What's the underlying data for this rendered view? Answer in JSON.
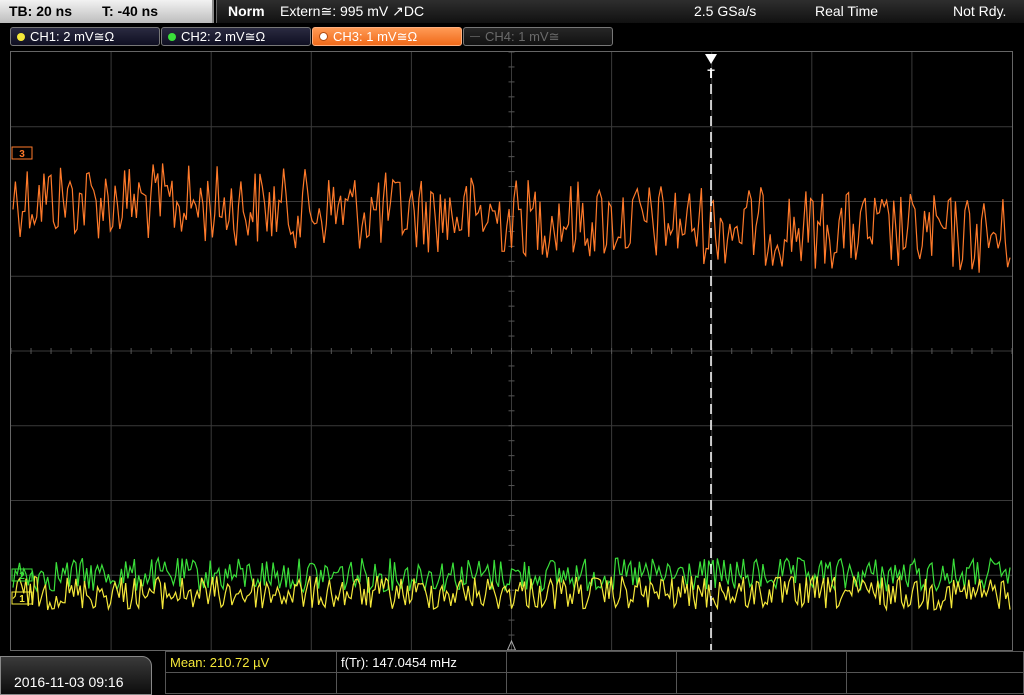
{
  "top": {
    "timebase": "TB: 20 ns",
    "trigger_offset": "T: -40 ns",
    "trigger_mode": "Norm",
    "trigger_source": "Extern≅: 995 mV ↗DC",
    "sample_rate": "2.5 GSa/s",
    "acq_mode": "Real Time",
    "status": "Not Rdy."
  },
  "channels": [
    {
      "label": "CH1: 2 mV≅Ω",
      "color": "#f5e83a",
      "state": "on"
    },
    {
      "label": "CH2: 2 mV≅Ω",
      "color": "#3adf3a",
      "state": "on"
    },
    {
      "label": "CH3: 1 mV≅Ω",
      "color": "#ff7a2a",
      "state": "active"
    },
    {
      "label": "CH4: 1 mV≅",
      "color": "#666666",
      "state": "off"
    }
  ],
  "markers": {
    "ch3": "3",
    "ch2": "2",
    "ch1": "1",
    "trigger": "T"
  },
  "colors": {
    "ch1": "#f5e83a",
    "ch2": "#3adf3a",
    "ch3": "#ff7a2a",
    "grid": "#3a3a3a"
  },
  "measurements": {
    "mean": "Mean: 210.72 µV",
    "freq": "f(Tr): 147.0454 mHz"
  },
  "datetime": "2016-11-03 09:16"
}
